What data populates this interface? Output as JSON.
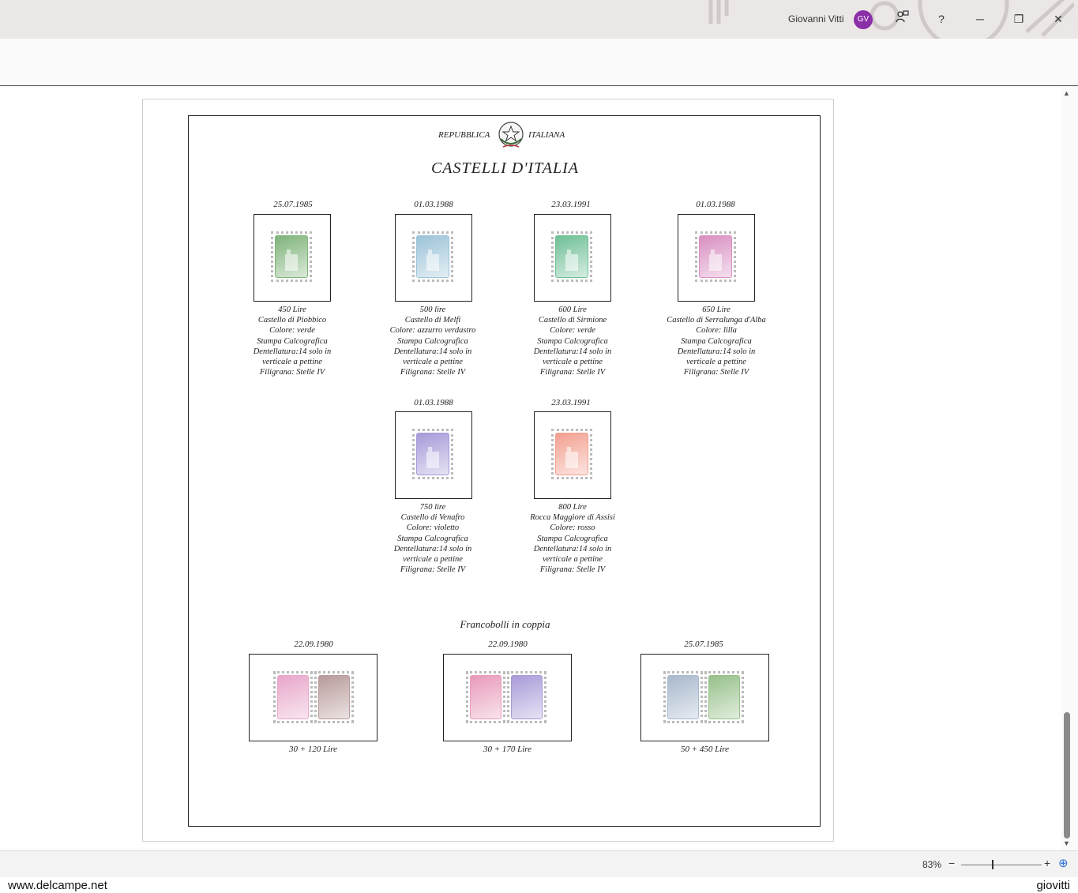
{
  "titlebar": {
    "user_name": "Giovanni Vitti",
    "avatar_initials": "GV",
    "feedback_icon": "person-feedback-icon",
    "help_label": "?",
    "minimize_label": "─",
    "restore_label": "❐",
    "close_label": "✕"
  },
  "document": {
    "header_left": "REPUBBLICA",
    "header_right": "ITALIANA",
    "emblem_icon": "italian-emblem-icon",
    "title": "CASTELLI   D'ITALIA",
    "stamps": [
      {
        "date": "25.07.1985",
        "color": "#7fb37a",
        "lines": [
          "450 Lire",
          "Castello di Piobbico",
          "Colore: verde",
          "Stampa Calcografica",
          "Dentellatura:14 solo in",
          "verticale a pettine",
          "Filigrana: Stelle IV"
        ]
      },
      {
        "date": "01.03.1988",
        "color": "#9cc3d8",
        "lines": [
          "500 lire",
          "Castello di Melfi",
          "Colore: azzurro verdastro",
          "Stampa Calcografica",
          "Dentellatura:14 solo in",
          "verticale a pettine",
          "Filigrana: Stelle IV"
        ]
      },
      {
        "date": "23.03.1991",
        "color": "#6fbf96",
        "lines": [
          "600 Lire",
          "Castello di Sirmione",
          "Colore: verde",
          "Stampa Calcografica",
          "Dentellatura:14 solo in",
          "verticale a pettine",
          "Filigrana: Stelle IV"
        ]
      },
      {
        "date": "01.03.1988",
        "color": "#d98fc2",
        "lines": [
          "650 Lire",
          "Castello di Serralunga d'Alba",
          "Colore: lilla",
          "Stampa Calcografica",
          "Dentellatura:14 solo in",
          "verticale a pettine",
          "Filigrana: Stelle IV"
        ]
      },
      {
        "date": "01.03.1988",
        "color": "#a79ad8",
        "lines": [
          "750 lire",
          "Castello di Venafro",
          "Colore: violetto",
          "Stampa Calcografica",
          "Dentellatura:14 solo in",
          "verticale a pettine",
          "Filigrana: Stelle IV"
        ]
      },
      {
        "date": "23.03.1991",
        "color": "#f2a090",
        "lines": [
          "800 Lire",
          "Rocca Maggiore di Assisi",
          "Colore: rosso",
          "Stampa Calcografica",
          "Dentellatura:14 solo in",
          "verticale a pettine",
          "Filigrana: Stelle IV"
        ]
      }
    ],
    "pairs_heading": "Francobolli in coppia",
    "pairs": [
      {
        "date": "22.09.1980",
        "caption": "30 + 120 Lire",
        "colors": [
          "#e8a6c9",
          "#b89a9a"
        ]
      },
      {
        "date": "22.09.1980",
        "caption": "30 + 170 Lire",
        "colors": [
          "#e89abb",
          "#a99ad8"
        ]
      },
      {
        "date": "25.07.1985",
        "caption": "50 + 450 Lire",
        "colors": [
          "#a8b8cc",
          "#96c08a"
        ]
      }
    ]
  },
  "statusbar": {
    "zoom": "83%",
    "zoom_minus": "−",
    "zoom_plus": "+",
    "fit_icon": "fit-page-icon"
  },
  "watermark": {
    "left": "www.delcampe.net",
    "right": "giovitti"
  }
}
